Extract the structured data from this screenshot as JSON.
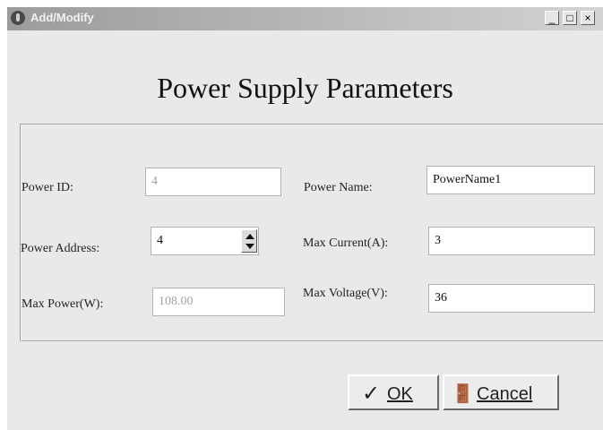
{
  "window": {
    "title": "Add/Modify",
    "minimize": "_",
    "maximize": "□",
    "close": "×"
  },
  "header": "Power Supply Parameters",
  "form": {
    "power_id_label": "Power ID:",
    "power_id_value": "4",
    "power_name_label": "Power Name:",
    "power_name_value": "PowerName1",
    "power_address_label": "Power Address:",
    "power_address_value": "4",
    "max_current_label": "Max Current(A):",
    "max_current_value": "3",
    "max_power_label": "Max Power(W):",
    "max_power_value": "108.00",
    "max_voltage_label": "Max Voltage(V):",
    "max_voltage_value": "36"
  },
  "buttons": {
    "ok_label": "OK",
    "ok_glyph": "✓",
    "cancel_label": "Cancel",
    "cancel_glyph": "🚪"
  }
}
